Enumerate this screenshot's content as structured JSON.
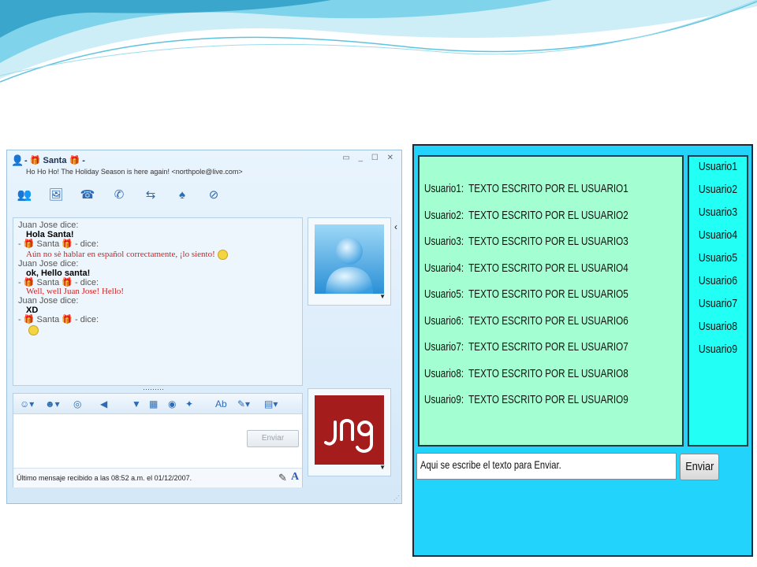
{
  "msn": {
    "title_prefix": "- ",
    "title_name": "Santa",
    "title_suffix": " -",
    "gift": "🎁",
    "subtitle": "Ho Ho Ho!  The Holiday Season is here again!  <northpole@live.com>",
    "window_buttons": "▭ _ ☐ ✕",
    "conversation": [
      {
        "sender": "Juan Jose dice:",
        "text": "Hola Santa!",
        "style": "bold"
      },
      {
        "sender": "Santa",
        "text": "Aún no sè hablar en español correctamente, ¡lo siento!",
        "style": "red",
        "emoticon": "sad"
      },
      {
        "sender": "Juan Jose dice:",
        "text": "ok, Hello santa!",
        "style": "bold"
      },
      {
        "sender": "Santa",
        "text": "Well, well Juan Jose! Hello!",
        "style": "red"
      },
      {
        "sender": "Juan Jose dice:",
        "text": "XD",
        "style": "bold"
      },
      {
        "sender": "Santa",
        "text": "",
        "style": "emoticon",
        "emoticon": "smile"
      }
    ],
    "santa_dice_prefix": "- ",
    "santa_dice_suffix": " - dice:",
    "send_button": "Enviar",
    "status": "Último mensaje recibido a las 08:52 a.m. el 01/12/2007.",
    "dots": "·········",
    "self_picture_text": "JNG",
    "toolbar_icons": [
      "add-contact-icon",
      "share-files-icon",
      "video-call-icon",
      "phone-call-icon",
      "activities-icon",
      "games-icon",
      "block-icon"
    ],
    "compose_icons": [
      "emoticon-icon",
      "wink-icon",
      "nudge-icon",
      "voice-clip-icon",
      "background-icon",
      "calendar-icon",
      "spell-icon",
      "font-icon",
      "color-icon",
      "more-icon"
    ]
  },
  "app": {
    "messages": [
      {
        "user": "Usuario1:",
        "text": "TEXTO ESCRITO POR EL USUARIO1"
      },
      {
        "user": "Usuario2:",
        "text": "TEXTO ESCRITO POR EL USUARIO2"
      },
      {
        "user": "Usuario3:",
        "text": "TEXTO ESCRITO POR EL USUARIO3"
      },
      {
        "user": "Usuario4:",
        "text": "TEXTO ESCRITO POR EL USUARIO4"
      },
      {
        "user": "Usuario5:",
        "text": "TEXTO ESCRITO POR EL USUARIO5"
      },
      {
        "user": "Usuario6:",
        "text": "TEXTO ESCRITO POR EL USUARIO6"
      },
      {
        "user": "Usuario7:",
        "text": "TEXTO ESCRITO POR EL USUARIO7"
      },
      {
        "user": "Usuario8:",
        "text": "TEXTO ESCRITO POR EL USUARIO8"
      },
      {
        "user": "Usuario9:",
        "text": "TEXTO ESCRITO POR EL USUARIO9"
      }
    ],
    "users": [
      "Usuario1",
      "Usuario2",
      "Usuario3",
      "Usuario4",
      "Usuario5",
      "Usuario6",
      "Usuario7",
      "Usuario8",
      "Usuario9"
    ],
    "input_value": "Aqui se escribe el texto para Enviar.",
    "send_label": "Enviar"
  },
  "colors": {
    "app_background": "#22d4fb",
    "messages_panel": "#a3ffd1",
    "users_panel": "#22fff5",
    "msn_red_text": "#d12020"
  }
}
